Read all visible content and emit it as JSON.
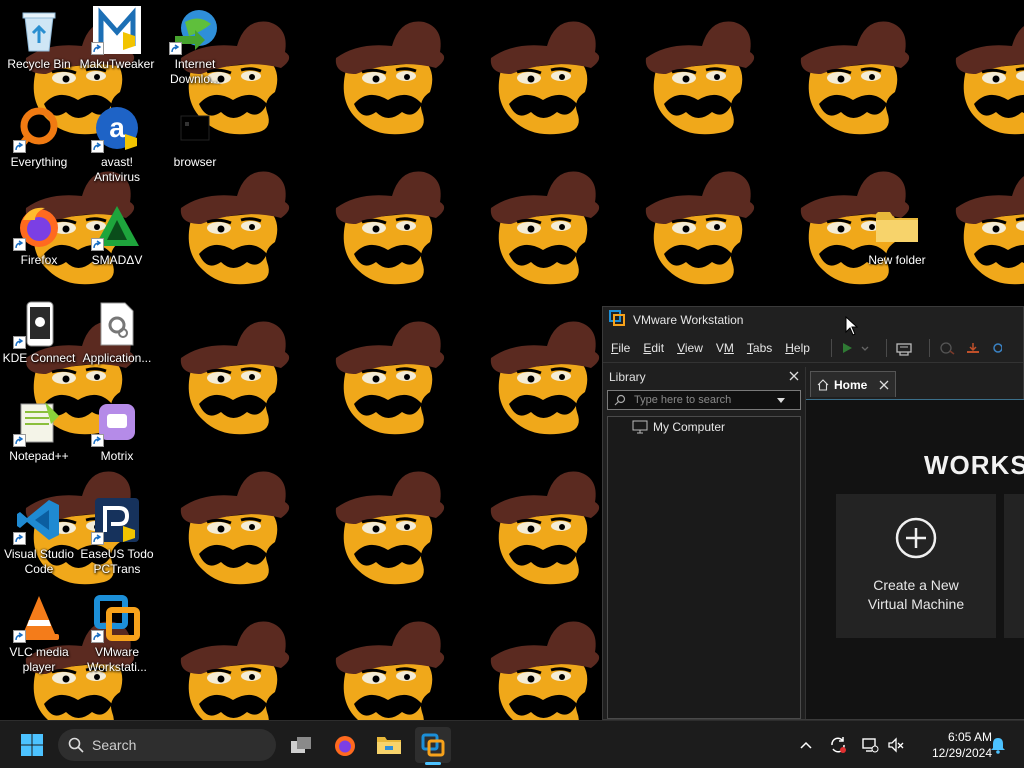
{
  "desktop": {
    "icons": [
      {
        "label": "Recycle Bin",
        "icon": "recycle-bin-icon"
      },
      {
        "label": "MakuTweaker",
        "icon": "makutweaker-icon"
      },
      {
        "label": "Internet Downlo...",
        "line1": "Internet",
        "line2": "Downlo...",
        "icon": "idm-icon"
      },
      {
        "label": "Everything",
        "icon": "everything-icon"
      },
      {
        "label": "avast! Antivirus",
        "line1": "avast!",
        "line2": "Antivirus",
        "icon": "avast-icon"
      },
      {
        "label": "browser",
        "icon": "browser-icon"
      },
      {
        "label": "Firefox",
        "icon": "firefox-icon"
      },
      {
        "label": "SMADΔV",
        "icon": "smadav-icon"
      },
      {
        "label": "New folder",
        "icon": "folder-icon"
      },
      {
        "label": "KDE Connect",
        "icon": "kde-connect-icon"
      },
      {
        "label": "Application...",
        "icon": "application-icon"
      },
      {
        "label": "Notepad++",
        "icon": "notepadpp-icon"
      },
      {
        "label": "Motrix",
        "icon": "motrix-icon"
      },
      {
        "label": "Visual Studio Code",
        "line1": "Visual Studio",
        "line2": "Code",
        "icon": "vscode-icon"
      },
      {
        "label": "EaseUS Todo PCTrans",
        "line1": "EaseUS Todo",
        "line2": "PCTrans",
        "icon": "easeus-icon"
      },
      {
        "label": "VLC media player",
        "line1": "VLC media",
        "line2": "player",
        "icon": "vlc-icon"
      },
      {
        "label": "VMware Workstati...",
        "line1": "VMware",
        "line2": "Workstati...",
        "icon": "vmware-icon"
      }
    ]
  },
  "vmware": {
    "title": "VMware Workstation",
    "menu": [
      {
        "label": "File",
        "key": "F",
        "rest": "ile"
      },
      {
        "label": "Edit",
        "key": "E",
        "rest": "dit"
      },
      {
        "label": "View",
        "key": "V",
        "rest": "iew"
      },
      {
        "label": "VM",
        "key": "V",
        "rest": "M"
      },
      {
        "label": "Tabs",
        "key": "T",
        "rest": "abs"
      },
      {
        "label": "Help",
        "key": "H",
        "rest": "elp"
      }
    ],
    "library": {
      "title": "Library",
      "search_placeholder": "Type here to search",
      "tree": [
        "My Computer"
      ]
    },
    "tabs": [
      {
        "label": "Home"
      }
    ],
    "home": {
      "brand": "WORKS",
      "create_line1": "Create a New",
      "create_line2": "Virtual Machine"
    }
  },
  "taskbar": {
    "search_label": "Search",
    "time": "6:05 AM",
    "date": "12/29/2024"
  },
  "colors": {
    "taskbar_bg": "#1c1c1c",
    "window_bg": "#1f1f1f",
    "accent": "#4cc2ff",
    "wallpaper_hat": "#5b2a20",
    "wallpaper_face": "#f0a81a"
  }
}
